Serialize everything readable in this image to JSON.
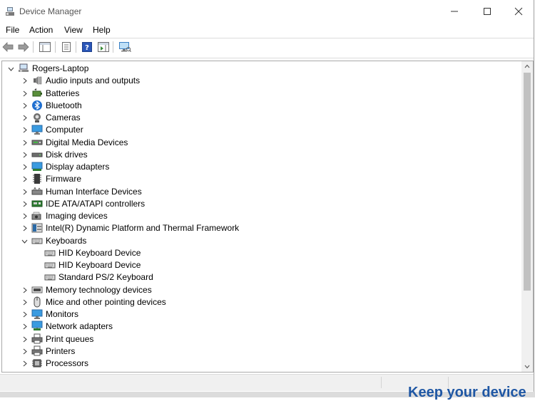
{
  "window": {
    "title": "Device Manager"
  },
  "menu": [
    "File",
    "Action",
    "View",
    "Help"
  ],
  "tree": {
    "root": "Rogers-Laptop",
    "items": [
      {
        "label": "Audio inputs and outputs",
        "icon": "speaker-icon"
      },
      {
        "label": "Batteries",
        "icon": "battery-icon"
      },
      {
        "label": "Bluetooth",
        "icon": "bluetooth-icon"
      },
      {
        "label": "Cameras",
        "icon": "camera-icon"
      },
      {
        "label": "Computer",
        "icon": "computer-icon"
      },
      {
        "label": "Digital Media Devices",
        "icon": "media-device-icon"
      },
      {
        "label": "Disk drives",
        "icon": "disk-drive-icon"
      },
      {
        "label": "Display adapters",
        "icon": "display-adapter-icon"
      },
      {
        "label": "Firmware",
        "icon": "firmware-icon"
      },
      {
        "label": "Human Interface Devices",
        "icon": "hid-icon"
      },
      {
        "label": "IDE ATA/ATAPI controllers",
        "icon": "ide-controller-icon"
      },
      {
        "label": "Imaging devices",
        "icon": "imaging-icon"
      },
      {
        "label": "Intel(R) Dynamic Platform and Thermal Framework",
        "icon": "intel-platform-icon"
      },
      {
        "label": "Keyboards",
        "icon": "keyboard-icon",
        "expanded": true,
        "children": [
          "HID Keyboard Device",
          "HID Keyboard Device",
          "Standard PS/2 Keyboard"
        ]
      },
      {
        "label": "Memory technology devices",
        "icon": "memory-icon"
      },
      {
        "label": "Mice and other pointing devices",
        "icon": "mouse-icon"
      },
      {
        "label": "Monitors",
        "icon": "monitor-icon"
      },
      {
        "label": "Network adapters",
        "icon": "network-adapter-icon"
      },
      {
        "label": "Print queues",
        "icon": "print-queue-icon"
      },
      {
        "label": "Printers",
        "icon": "printer-icon"
      },
      {
        "label": "Processors",
        "icon": "processor-icon"
      }
    ]
  },
  "background_text": "Keep your device"
}
